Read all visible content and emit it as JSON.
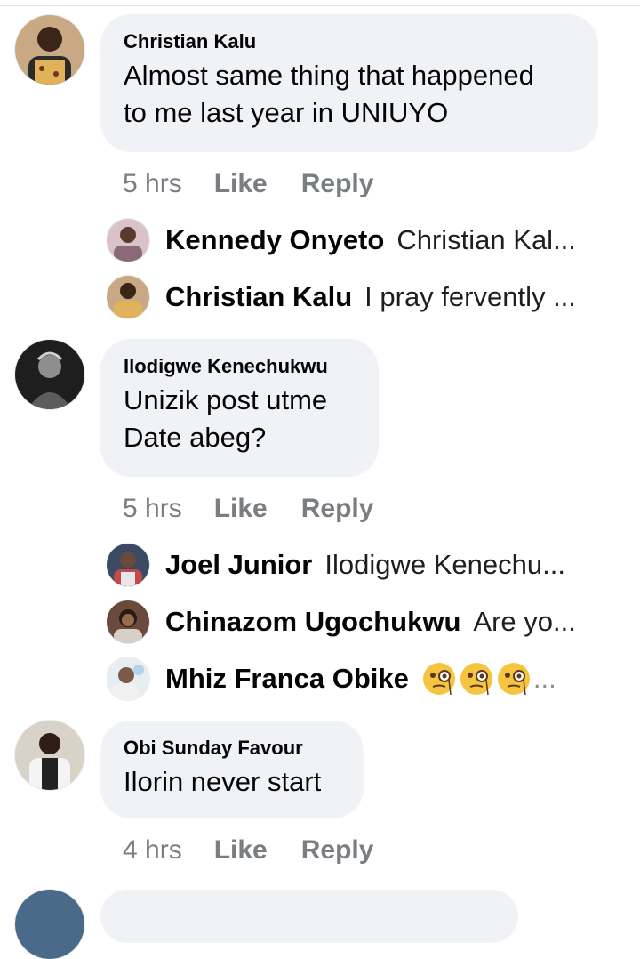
{
  "comments": [
    {
      "author": "Christian Kalu",
      "text": "Almost same thing that happened\nto me last year in UNIUYO",
      "time": "5 hrs",
      "like_label": "Like",
      "reply_label": "Reply",
      "replies": [
        {
          "name": "Kennedy Onyeto",
          "preview": "Christian Kal..."
        },
        {
          "name": "Christian Kalu",
          "preview": "I pray fervently ..."
        }
      ]
    },
    {
      "author": "Ilodigwe Kenechukwu",
      "text": "Unizik post utme\nDate abeg?",
      "time": "5 hrs",
      "like_label": "Like",
      "reply_label": "Reply",
      "replies": [
        {
          "name": "Joel Junior",
          "preview": "Ilodigwe Kenechu..."
        },
        {
          "name": "Chinazom Ugochukwu",
          "preview": "Are yo..."
        },
        {
          "name": "Mhiz Franca Obike",
          "preview": "...",
          "emoji": [
            "face-with-monocle-icon",
            "face-with-monocle-icon",
            "face-with-monocle-icon"
          ]
        }
      ]
    },
    {
      "author": "Obi Sunday Favour",
      "text": "Ilorin never start",
      "time": "4 hrs",
      "like_label": "Like",
      "reply_label": "Reply",
      "replies": []
    }
  ],
  "colors": {
    "bubble": "#f0f2f5",
    "meta_text": "#65676b",
    "name_text": "#050505"
  }
}
